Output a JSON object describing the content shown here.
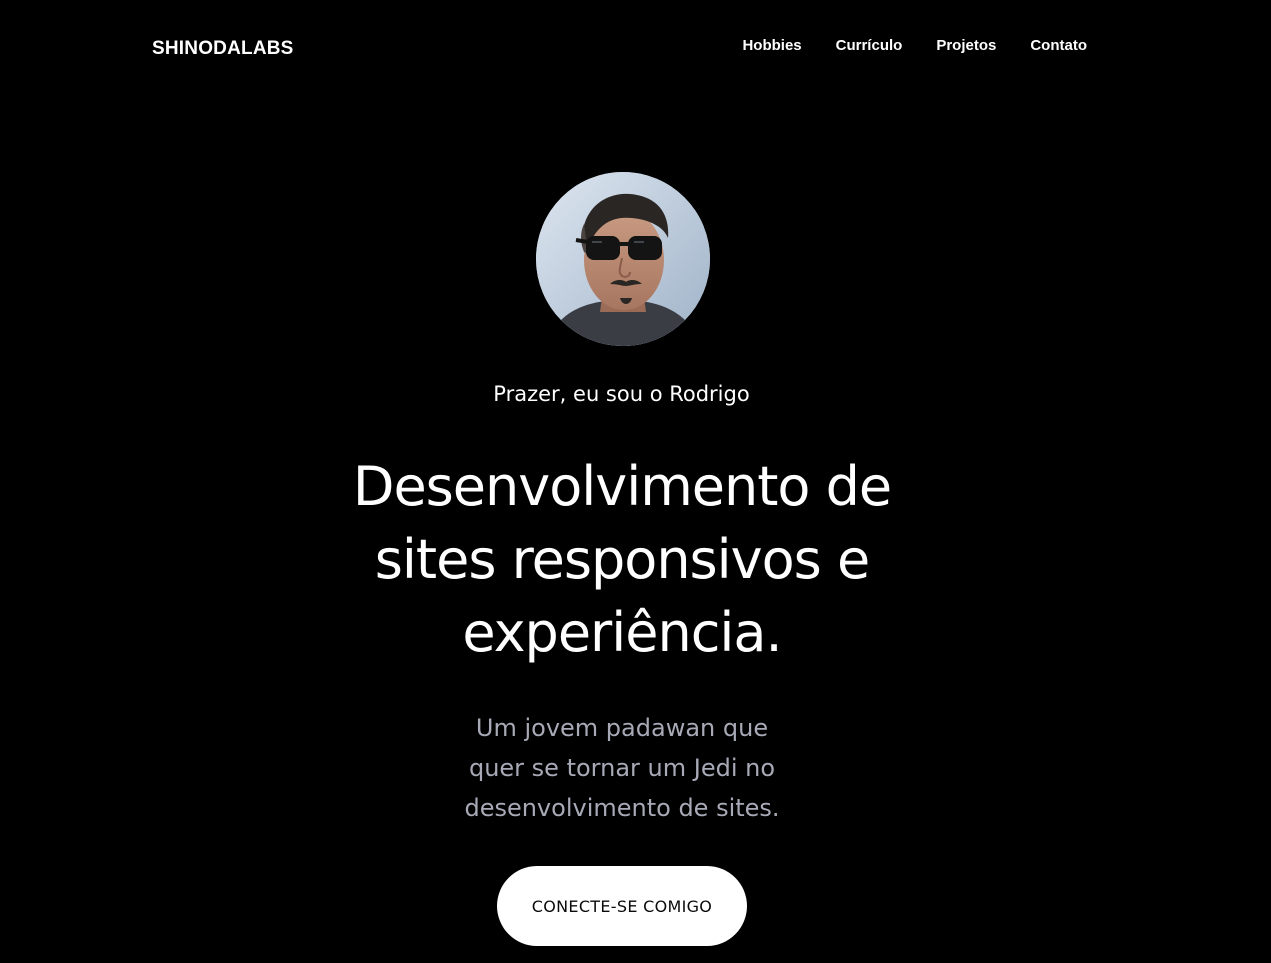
{
  "header": {
    "brand": "SHINODALABS",
    "nav": [
      {
        "label": "Hobbies"
      },
      {
        "label": "Currículo"
      },
      {
        "label": "Projetos"
      },
      {
        "label": "Contato"
      }
    ]
  },
  "hero": {
    "greeting": "Prazer, eu sou o Rodrigo",
    "headline": "Desenvolvimento de sites responsivos e experiência.",
    "tagline": "Um jovem padawan que quer se tornar um Jedi no desenvolvimento de sites.",
    "cta_label": "CONECTE-SE COMIGO"
  },
  "colors": {
    "background": "#000000",
    "text": "#ffffff",
    "tagline": "#a7aab6",
    "button_bg": "#ffffff",
    "button_text": "#0b0b0b"
  }
}
